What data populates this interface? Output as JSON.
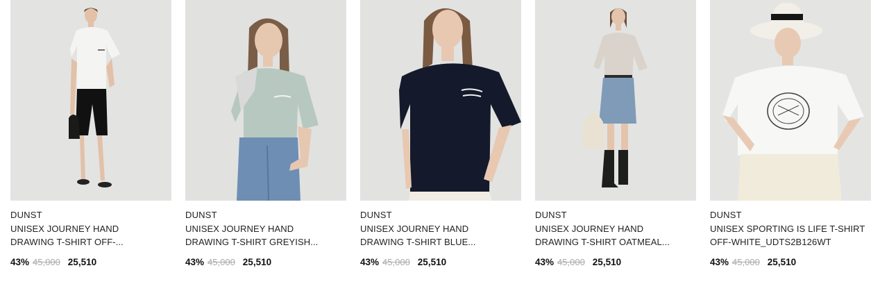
{
  "products": [
    {
      "brand": "DUNST",
      "name_line1": "UNISEX JOURNEY HAND",
      "name_line2": "DRAWING T-SHIRT OFF-...",
      "discount": "43%",
      "original_price": "45,000",
      "sale_price": "25,510",
      "shirt_color": "#f4f4f2"
    },
    {
      "brand": "DUNST",
      "name_line1": "UNISEX JOURNEY HAND",
      "name_line2": "DRAWING T-SHIRT GREYISH...",
      "discount": "43%",
      "original_price": "45,000",
      "sale_price": "25,510",
      "shirt_color": "#b6c8bf"
    },
    {
      "brand": "DUNST",
      "name_line1": "UNISEX JOURNEY HAND",
      "name_line2": "DRAWING T-SHIRT BLUE...",
      "discount": "43%",
      "original_price": "45,000",
      "sale_price": "25,510",
      "shirt_color": "#141a2b"
    },
    {
      "brand": "DUNST",
      "name_line1": "UNISEX JOURNEY HAND",
      "name_line2": "DRAWING T-SHIRT OATMEAL...",
      "discount": "43%",
      "original_price": "45,000",
      "sale_price": "25,510",
      "shirt_color": "#d9d3cb"
    },
    {
      "brand": "DUNST",
      "name_line1": "UNISEX SPORTING IS LIFE T-SHIRT",
      "name_line2": "OFF-WHITE_UDTS2B126WT",
      "discount": "43%",
      "original_price": "45,000",
      "sale_price": "25,510",
      "shirt_color": "#f7f7f5"
    }
  ]
}
